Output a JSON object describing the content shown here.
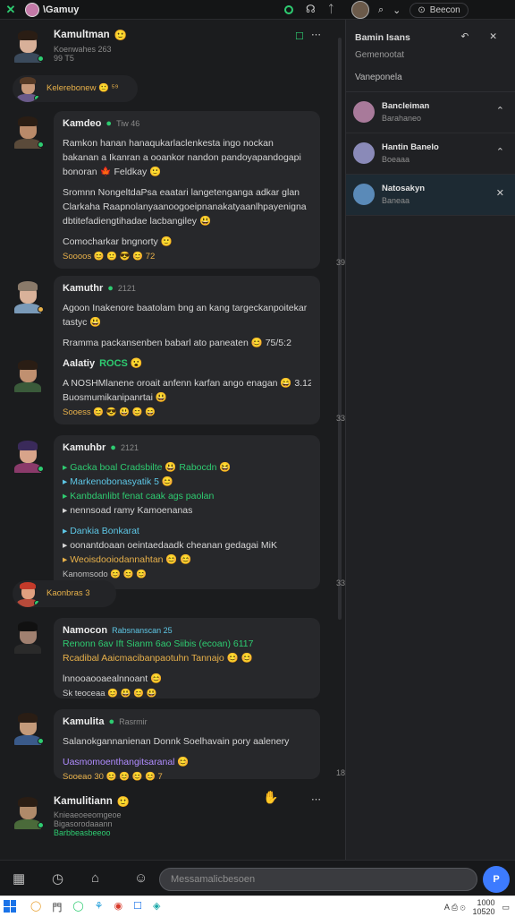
{
  "topbar": {
    "title": "\\Gamuy",
    "close": "✕",
    "icons": [
      "◉",
      "☊",
      "ᛏ"
    ],
    "right_icons": [
      "⌕",
      "⌄"
    ],
    "right_button": "Beecon"
  },
  "chat": {
    "header_msg": {
      "name": "Kamultman",
      "meta1": "Koenwahes 263",
      "meta2": "99 T5",
      "badge": "☐",
      "more": "⋯"
    },
    "sys1": {
      "text": "Kelerebonew 🙂 ⁵⁹"
    },
    "m1": {
      "name": "Kamdeo",
      "meta": "Tiw 46",
      "lines": [
        "Ramkon hanan hanaqukarlaclenkesta ingo nockan",
        "bakanan a Ikanran a ooankor nandon pandoyapandogapi",
        "bonoran 🍁 Feldkay 🙂"
      ],
      "lines2": [
        "Sromnn NongeltdaPsa eaatari langetenganga adkar glan",
        "Clarkaha Raapnolanyaanoogoeipnanakatyaanlhpayenigna",
        "dbtitefadiengtihadae lacbangiley 😃"
      ],
      "line3": "Comocharkar bngnorty 🙂",
      "reacts": "Soooos 😊 🙂 😎 😊 72",
      "count": "39"
    },
    "m2": {
      "name": "Kamuthr",
      "meta": "2121",
      "lines": [
        "Agoon Inakenore baatolam bng an kang targeckanpoitekar",
        "tastyc 😃"
      ],
      "line2": "Rramma packansenben babarl ato paneaten 😊 75/5:2",
      "name2": "Aalatiy",
      "name2meta": "ROCS 😮",
      "line3": "A NOSHMlanene oroait anfenn karfan ango enagan 😄 3.12",
      "line4": "Buosmumikanipanrtai 😃",
      "reacts": "Sooess 😊 😎 😃 😊 😄",
      "count": "33"
    },
    "m3": {
      "name": "Kamuhbr",
      "meta": "2121",
      "items": [
        "Gacka boal Cradsbilte 😃 Rabocdn 😆",
        "Markenobonasyatik 5 😊",
        "Kanbdanlibt fenat caak ags paolan",
        "nennsoad ramy Kamoenanas",
        "Dankia Bonkarat",
        "oonantdoaan oeintaedaadk cheanan gedagai MiK",
        "Weoisdooiodannahtan 😊 😊"
      ],
      "reacts": "Kanomsodo 😊 😊 😊",
      "count": "33"
    },
    "sys2": {
      "text": "Kaonbras 3"
    },
    "m4": {
      "name": "Namocon",
      "meta": "Rabsnanscan 25",
      "line1": "Renonn 6av Ift Sianm 6ao Siibis (ecoan) 6117",
      "line2": "Rcadibal Aaicmacibanpaotuhn Tannajo 😊 😊",
      "line3": "lnnooaooaealnnoant 😊",
      "reacts": "Sk teoceaa 😊 😃 😊 😃",
      "count": ""
    },
    "m5": {
      "name": "Kamulita",
      "meta": "Rasrmir",
      "line1": "Salanokgannanienan Donnk Soelhavain pory aalenery",
      "line2": "Uasmomoenthangitsaranal 😊",
      "reacts": "Sooeao 30 😊 😊 😊 😊 7",
      "count": "18"
    },
    "m6": {
      "name": "Kamulitiann",
      "meta1": "Knieaeoeeomgeoe",
      "meta2": "Bigasorodaaann",
      "meta3": "Barbbeasbeeoo",
      "more": "⋯"
    }
  },
  "panel": {
    "title": "Bamin Isans",
    "subtitle": "Gemenootat",
    "icons": "↶ ✕",
    "section": "Vaneponela",
    "items": [
      {
        "name": "Bancleiman",
        "meta": "Barahaneo",
        "action": "⌃"
      },
      {
        "name": "Hantin Banelo",
        "meta": "Boeaaa",
        "action": "⌃"
      },
      {
        "name": "Natosakyn",
        "meta": "Baneaa",
        "action": "✕"
      }
    ]
  },
  "composer": {
    "placeholder": "Messamalicbesoen",
    "send": "P"
  },
  "taskbar": {
    "apps": [
      "◯",
      "門",
      "◯",
      "⚘",
      "◉",
      "☐",
      "◈"
    ],
    "tray": "A   ⎙   ⊙",
    "time": "1000",
    "date": "10520"
  },
  "colors": {
    "accent": "#2ecc71",
    "send": "#3d7bff",
    "bubble": "#27282b"
  }
}
